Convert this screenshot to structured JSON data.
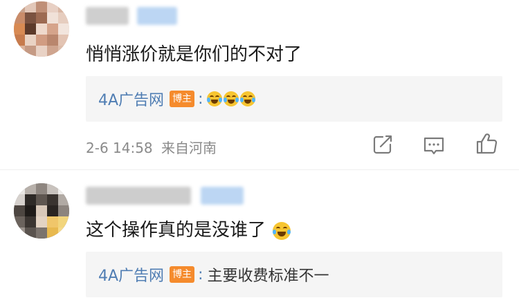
{
  "comments": [
    {
      "text": "悄悄涨价就是你们的不对了",
      "reply": {
        "author": "4A广告网",
        "badge": "博主",
        "colon": ":",
        "emojis": [
          "laugh-cry-emoji",
          "laugh-cry-emoji",
          "laugh-cry-emoji"
        ]
      },
      "timestamp": "2-6 14:58",
      "location": "来自河南"
    },
    {
      "text": "这个操作真的是没谁了",
      "reply": {
        "author": "4A广告网",
        "badge": "博主",
        "colon": ":",
        "text": "主要收费标准不一"
      }
    }
  ],
  "icons": {
    "edit": "share-edit-icon",
    "comment": "comment-icon",
    "like": "thumbs-up-icon"
  },
  "colors": {
    "author_link": "#4f7db3",
    "badge": "#f58b2d",
    "reply_bg": "#f5f5f5",
    "meta": "#8a8a8a"
  }
}
